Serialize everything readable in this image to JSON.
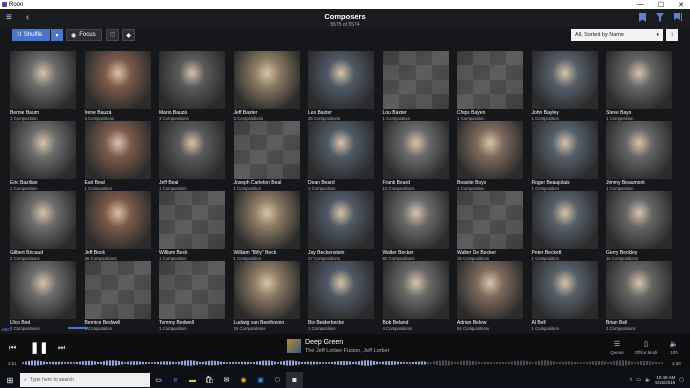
{
  "window": {
    "app_name": "Roon",
    "minimize": "—",
    "maximize": "☐",
    "close": "✕"
  },
  "header": {
    "menu_icon": "hamburger-icon",
    "back_icon": "back-arrow-icon",
    "title": "Composers",
    "subtitle": "5575 of 5574",
    "right_icons": [
      "bookmark-icon",
      "filter-icon",
      "bookmarks-list-icon"
    ]
  },
  "toolbar": {
    "shuffle_label": "Shuffle",
    "focus_label": "Focus",
    "sort_value": "All, Sorted by Name"
  },
  "composers": [
    {
      "name": "Bernie Baum",
      "count": "1 Composition",
      "image": "photo"
    },
    {
      "name": "Irene Bauzá",
      "count": "4 Compositions",
      "image": "photo"
    },
    {
      "name": "Mario Bauzá",
      "count": "3 Compositions",
      "image": "photo"
    },
    {
      "name": "Jeff Baxter",
      "count": "3 Compositions",
      "image": "photo"
    },
    {
      "name": "Les Baxter",
      "count": "25 Compositions",
      "image": "photo"
    },
    {
      "name": "Lou Baxter",
      "count": "1 Composition",
      "image": "placeholder"
    },
    {
      "name": "Chips Bayen",
      "count": "1 Composition",
      "image": "placeholder"
    },
    {
      "name": "John Bayley",
      "count": "1 Composition",
      "image": "photo"
    },
    {
      "name": "Steve Bays",
      "count": "1 Composition",
      "image": "photo"
    },
    {
      "name": "Eric Bazilian",
      "count": "1 Composition",
      "image": "photo"
    },
    {
      "name": "Earl Beal",
      "count": "1 Composition",
      "image": "photo"
    },
    {
      "name": "Jeff Beal",
      "count": "1 Composition",
      "image": "photo"
    },
    {
      "name": "Joseph Carleton Beal",
      "count": "1 Composition",
      "image": "placeholder"
    },
    {
      "name": "Dean Beard",
      "count": "1 Composition",
      "image": "photo"
    },
    {
      "name": "Frank Beard",
      "count": "12 Compositions",
      "image": "photo"
    },
    {
      "name": "Beastie Boys",
      "count": "1 Composition",
      "image": "photo"
    },
    {
      "name": "Roger Beaujolais",
      "count": "1 Composition",
      "image": "photo"
    },
    {
      "name": "Jimmy Beaumont",
      "count": "1 Composition",
      "image": "photo"
    },
    {
      "name": "Gilbert Bécaud",
      "count": "2 Compositions",
      "image": "photo"
    },
    {
      "name": "Jeff Beck",
      "count": "36 Compositions",
      "image": "photo"
    },
    {
      "name": "William Beck",
      "count": "1 Composition",
      "image": "placeholder"
    },
    {
      "name": "William \"Billy\" Beck",
      "count": "1 Composition",
      "image": "photo"
    },
    {
      "name": "Jay Beckenstein",
      "count": "27 Compositions",
      "image": "photo"
    },
    {
      "name": "Walter Becker",
      "count": "82 Compositions",
      "image": "photo"
    },
    {
      "name": "Walter De Becker",
      "count": "15 Compositions",
      "image": "placeholder"
    },
    {
      "name": "Peter Beckett",
      "count": "1 Composition",
      "image": "photo"
    },
    {
      "name": "Gerry Beckley",
      "count": "16 Compositions",
      "image": "photo"
    },
    {
      "name": "Ulco Bed",
      "count": "2 Compositions",
      "image": "photo"
    },
    {
      "name": "Bernice Bedwell",
      "count": "1 Composition",
      "image": "placeholder"
    },
    {
      "name": "Tommy Bedwell",
      "count": "1 Composition",
      "image": "placeholder"
    },
    {
      "name": "Ludwig van Beethoven",
      "count": "15 Compositions",
      "image": "photo"
    },
    {
      "name": "Bix Beiderbecke",
      "count": "1 Composition",
      "image": "photo"
    },
    {
      "name": "Bob Beland",
      "count": "4 Compositions",
      "image": "photo"
    },
    {
      "name": "Adrian Belew",
      "count": "54 Compositions",
      "image": "photo"
    },
    {
      "name": "Al Bell",
      "count": "1 Composition",
      "image": "photo"
    },
    {
      "name": "Brian Bell",
      "count": "3 Compositions",
      "image": "photo"
    }
  ],
  "alpha_jump": "ABC",
  "player": {
    "track_title": "Deep Green",
    "track_artist": "The Jeff Lorber Fusion, Jeff Lorber",
    "time_elapsed": "2:51",
    "time_total": "4:30",
    "progress": 0.63,
    "queue_label": "Queue",
    "zone_label": "Office Modi",
    "volume_label": "100"
  },
  "taskbar": {
    "search_placeholder": "Type here to search",
    "time": "10:49 AM",
    "date": "5/16/2019"
  },
  "colors": {
    "accent": "#4a76c8",
    "background": "#16171a",
    "icon_accent": "#5c82d8"
  }
}
